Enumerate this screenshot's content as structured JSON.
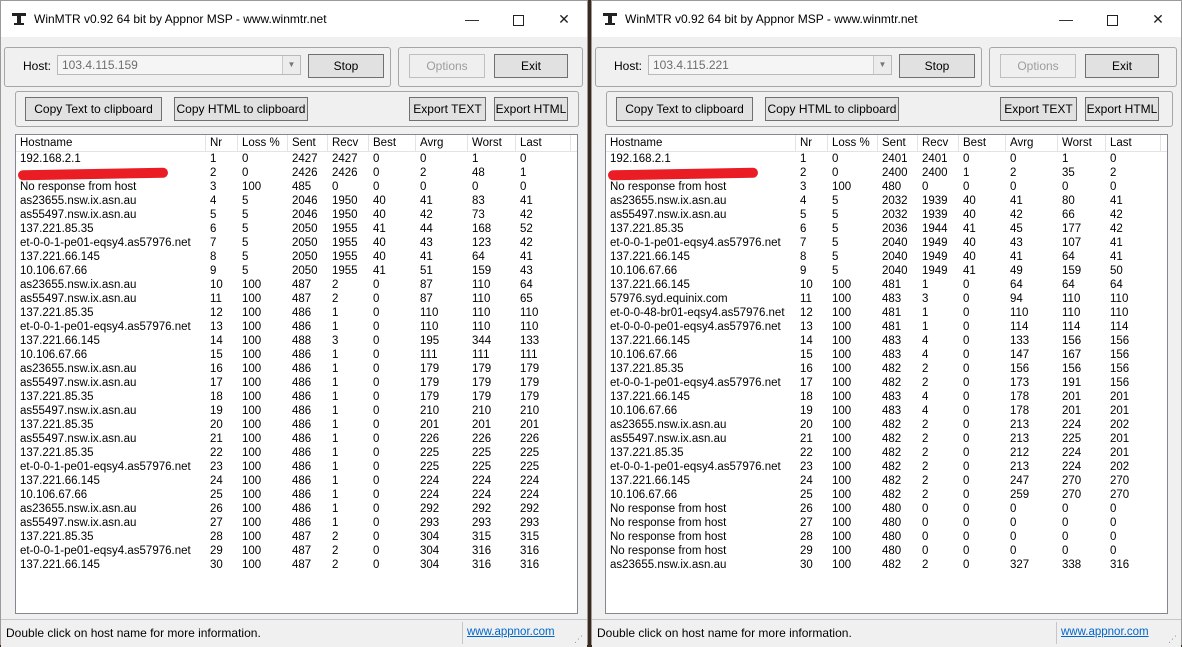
{
  "windows": [
    {
      "title": "WinMTR v0.92 64 bit by Appnor MSP - www.winmtr.net",
      "host_label": "Host:",
      "host_value": "103.4.115.159",
      "buttons": {
        "stop": "Stop",
        "options": "Options",
        "exit": "Exit",
        "copy_text": "Copy Text to clipboard",
        "copy_html": "Copy HTML to clipboard",
        "export_text": "Export TEXT",
        "export_html": "Export HTML"
      },
      "columns": [
        "Hostname",
        "Nr",
        "Loss %",
        "Sent",
        "Recv",
        "Best",
        "Avrg",
        "Worst",
        "Last"
      ],
      "rows": [
        [
          "192.168.2.1",
          "1",
          "0",
          "2427",
          "2427",
          "0",
          "0",
          "1",
          "0"
        ],
        [
          "",
          "2",
          "0",
          "2426",
          "2426",
          "0",
          "2",
          "48",
          "1"
        ],
        [
          "No response from host",
          "3",
          "100",
          "485",
          "0",
          "0",
          "0",
          "0",
          "0"
        ],
        [
          "as23655.nsw.ix.asn.au",
          "4",
          "5",
          "2046",
          "1950",
          "40",
          "41",
          "83",
          "41"
        ],
        [
          "as55497.nsw.ix.asn.au",
          "5",
          "5",
          "2046",
          "1950",
          "40",
          "42",
          "73",
          "42"
        ],
        [
          "137.221.85.35",
          "6",
          "5",
          "2050",
          "1955",
          "41",
          "44",
          "168",
          "52"
        ],
        [
          "et-0-0-1-pe01-eqsy4.as57976.net",
          "7",
          "5",
          "2050",
          "1955",
          "40",
          "43",
          "123",
          "42"
        ],
        [
          "137.221.66.145",
          "8",
          "5",
          "2050",
          "1955",
          "40",
          "41",
          "64",
          "41"
        ],
        [
          "10.106.67.66",
          "9",
          "5",
          "2050",
          "1955",
          "41",
          "51",
          "159",
          "43"
        ],
        [
          "as23655.nsw.ix.asn.au",
          "10",
          "100",
          "487",
          "2",
          "0",
          "87",
          "110",
          "64"
        ],
        [
          "as55497.nsw.ix.asn.au",
          "11",
          "100",
          "487",
          "2",
          "0",
          "87",
          "110",
          "65"
        ],
        [
          "137.221.85.35",
          "12",
          "100",
          "486",
          "1",
          "0",
          "110",
          "110",
          "110"
        ],
        [
          "et-0-0-1-pe01-eqsy4.as57976.net",
          "13",
          "100",
          "486",
          "1",
          "0",
          "110",
          "110",
          "110"
        ],
        [
          "137.221.66.145",
          "14",
          "100",
          "488",
          "3",
          "0",
          "195",
          "344",
          "133"
        ],
        [
          "10.106.67.66",
          "15",
          "100",
          "486",
          "1",
          "0",
          "111",
          "111",
          "111"
        ],
        [
          "as23655.nsw.ix.asn.au",
          "16",
          "100",
          "486",
          "1",
          "0",
          "179",
          "179",
          "179"
        ],
        [
          "as55497.nsw.ix.asn.au",
          "17",
          "100",
          "486",
          "1",
          "0",
          "179",
          "179",
          "179"
        ],
        [
          "137.221.85.35",
          "18",
          "100",
          "486",
          "1",
          "0",
          "179",
          "179",
          "179"
        ],
        [
          "as55497.nsw.ix.asn.au",
          "19",
          "100",
          "486",
          "1",
          "0",
          "210",
          "210",
          "210"
        ],
        [
          "137.221.85.35",
          "20",
          "100",
          "486",
          "1",
          "0",
          "201",
          "201",
          "201"
        ],
        [
          "as55497.nsw.ix.asn.au",
          "21",
          "100",
          "486",
          "1",
          "0",
          "226",
          "226",
          "226"
        ],
        [
          "137.221.85.35",
          "22",
          "100",
          "486",
          "1",
          "0",
          "225",
          "225",
          "225"
        ],
        [
          "et-0-0-1-pe01-eqsy4.as57976.net",
          "23",
          "100",
          "486",
          "1",
          "0",
          "225",
          "225",
          "225"
        ],
        [
          "137.221.66.145",
          "24",
          "100",
          "486",
          "1",
          "0",
          "224",
          "224",
          "224"
        ],
        [
          "10.106.67.66",
          "25",
          "100",
          "486",
          "1",
          "0",
          "224",
          "224",
          "224"
        ],
        [
          "as23655.nsw.ix.asn.au",
          "26",
          "100",
          "486",
          "1",
          "0",
          "292",
          "292",
          "292"
        ],
        [
          "as55497.nsw.ix.asn.au",
          "27",
          "100",
          "486",
          "1",
          "0",
          "293",
          "293",
          "293"
        ],
        [
          "137.221.85.35",
          "28",
          "100",
          "487",
          "2",
          "0",
          "304",
          "315",
          "315"
        ],
        [
          "et-0-0-1-pe01-eqsy4.as57976.net",
          "29",
          "100",
          "487",
          "2",
          "0",
          "304",
          "316",
          "316"
        ],
        [
          "137.221.66.145",
          "30",
          "100",
          "487",
          "2",
          "0",
          "304",
          "316",
          "316"
        ]
      ],
      "status_text": "Double click on host name for more information.",
      "link": "www.appnor.com"
    },
    {
      "title": "WinMTR v0.92 64 bit by Appnor MSP - www.winmtr.net",
      "host_label": "Host:",
      "host_value": "103.4.115.221",
      "buttons": {
        "stop": "Stop",
        "options": "Options",
        "exit": "Exit",
        "copy_text": "Copy Text to clipboard",
        "copy_html": "Copy HTML to clipboard",
        "export_text": "Export TEXT",
        "export_html": "Export HTML"
      },
      "columns": [
        "Hostname",
        "Nr",
        "Loss %",
        "Sent",
        "Recv",
        "Best",
        "Avrg",
        "Worst",
        "Last"
      ],
      "rows": [
        [
          "192.168.2.1",
          "1",
          "0",
          "2401",
          "2401",
          "0",
          "0",
          "1",
          "0"
        ],
        [
          "",
          "2",
          "0",
          "2400",
          "2400",
          "1",
          "2",
          "35",
          "2"
        ],
        [
          "No response from host",
          "3",
          "100",
          "480",
          "0",
          "0",
          "0",
          "0",
          "0"
        ],
        [
          "as23655.nsw.ix.asn.au",
          "4",
          "5",
          "2032",
          "1939",
          "40",
          "41",
          "80",
          "41"
        ],
        [
          "as55497.nsw.ix.asn.au",
          "5",
          "5",
          "2032",
          "1939",
          "40",
          "42",
          "66",
          "42"
        ],
        [
          "137.221.85.35",
          "6",
          "5",
          "2036",
          "1944",
          "41",
          "45",
          "177",
          "42"
        ],
        [
          "et-0-0-1-pe01-eqsy4.as57976.net",
          "7",
          "5",
          "2040",
          "1949",
          "40",
          "43",
          "107",
          "41"
        ],
        [
          "137.221.66.145",
          "8",
          "5",
          "2040",
          "1949",
          "40",
          "41",
          "64",
          "41"
        ],
        [
          "10.106.67.66",
          "9",
          "5",
          "2040",
          "1949",
          "41",
          "49",
          "159",
          "50"
        ],
        [
          "137.221.66.145",
          "10",
          "100",
          "481",
          "1",
          "0",
          "64",
          "64",
          "64"
        ],
        [
          "57976.syd.equinix.com",
          "11",
          "100",
          "483",
          "3",
          "0",
          "94",
          "110",
          "110"
        ],
        [
          "et-0-0-48-br01-eqsy4.as57976.net",
          "12",
          "100",
          "481",
          "1",
          "0",
          "110",
          "110",
          "110"
        ],
        [
          "et-0-0-0-pe01-eqsy4.as57976.net",
          "13",
          "100",
          "481",
          "1",
          "0",
          "114",
          "114",
          "114"
        ],
        [
          "137.221.66.145",
          "14",
          "100",
          "483",
          "4",
          "0",
          "133",
          "156",
          "156"
        ],
        [
          "10.106.67.66",
          "15",
          "100",
          "483",
          "4",
          "0",
          "147",
          "167",
          "156"
        ],
        [
          "137.221.85.35",
          "16",
          "100",
          "482",
          "2",
          "0",
          "156",
          "156",
          "156"
        ],
        [
          "et-0-0-1-pe01-eqsy4.as57976.net",
          "17",
          "100",
          "482",
          "2",
          "0",
          "173",
          "191",
          "156"
        ],
        [
          "137.221.66.145",
          "18",
          "100",
          "483",
          "4",
          "0",
          "178",
          "201",
          "201"
        ],
        [
          "10.106.67.66",
          "19",
          "100",
          "483",
          "4",
          "0",
          "178",
          "201",
          "201"
        ],
        [
          "as23655.nsw.ix.asn.au",
          "20",
          "100",
          "482",
          "2",
          "0",
          "213",
          "224",
          "202"
        ],
        [
          "as55497.nsw.ix.asn.au",
          "21",
          "100",
          "482",
          "2",
          "0",
          "213",
          "225",
          "201"
        ],
        [
          "137.221.85.35",
          "22",
          "100",
          "482",
          "2",
          "0",
          "212",
          "224",
          "201"
        ],
        [
          "et-0-0-1-pe01-eqsy4.as57976.net",
          "23",
          "100",
          "482",
          "2",
          "0",
          "213",
          "224",
          "202"
        ],
        [
          "137.221.66.145",
          "24",
          "100",
          "482",
          "2",
          "0",
          "247",
          "270",
          "270"
        ],
        [
          "10.106.67.66",
          "25",
          "100",
          "482",
          "2",
          "0",
          "259",
          "270",
          "270"
        ],
        [
          "No response from host",
          "26",
          "100",
          "480",
          "0",
          "0",
          "0",
          "0",
          "0"
        ],
        [
          "No response from host",
          "27",
          "100",
          "480",
          "0",
          "0",
          "0",
          "0",
          "0"
        ],
        [
          "No response from host",
          "28",
          "100",
          "480",
          "0",
          "0",
          "0",
          "0",
          "0"
        ],
        [
          "No response from host",
          "29",
          "100",
          "480",
          "0",
          "0",
          "0",
          "0",
          "0"
        ],
        [
          "as23655.nsw.ix.asn.au",
          "30",
          "100",
          "482",
          "2",
          "0",
          "327",
          "338",
          "316"
        ]
      ],
      "status_text": "Double click on host name for more information.",
      "link": "www.appnor.com"
    }
  ],
  "colors": {
    "redaction": "#ea1c24",
    "link": "#0066cc"
  }
}
